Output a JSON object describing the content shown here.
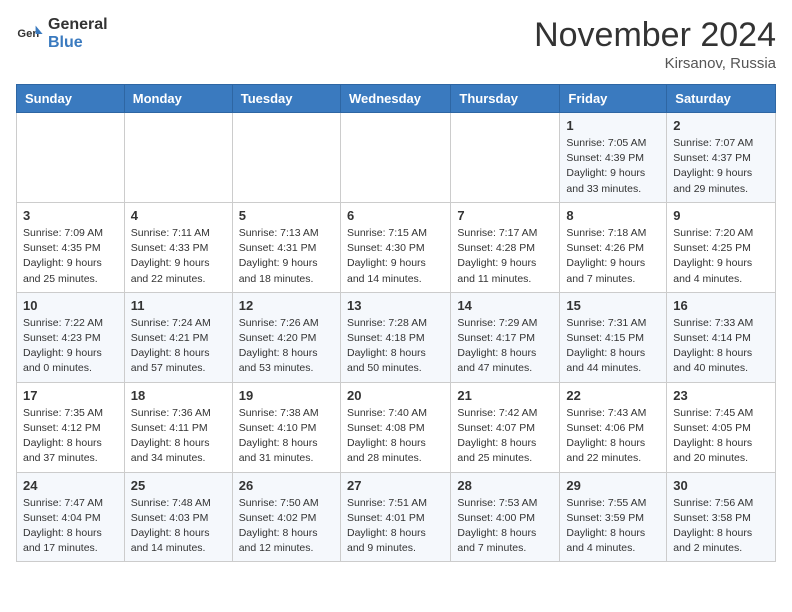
{
  "logo": {
    "text_general": "General",
    "text_blue": "Blue"
  },
  "title": {
    "month_year": "November 2024",
    "location": "Kirsanov, Russia"
  },
  "weekdays": [
    "Sunday",
    "Monday",
    "Tuesday",
    "Wednesday",
    "Thursday",
    "Friday",
    "Saturday"
  ],
  "weeks": [
    [
      {
        "day": "",
        "info": ""
      },
      {
        "day": "",
        "info": ""
      },
      {
        "day": "",
        "info": ""
      },
      {
        "day": "",
        "info": ""
      },
      {
        "day": "",
        "info": ""
      },
      {
        "day": "1",
        "info": "Sunrise: 7:05 AM\nSunset: 4:39 PM\nDaylight: 9 hours and 33 minutes."
      },
      {
        "day": "2",
        "info": "Sunrise: 7:07 AM\nSunset: 4:37 PM\nDaylight: 9 hours and 29 minutes."
      }
    ],
    [
      {
        "day": "3",
        "info": "Sunrise: 7:09 AM\nSunset: 4:35 PM\nDaylight: 9 hours and 25 minutes."
      },
      {
        "day": "4",
        "info": "Sunrise: 7:11 AM\nSunset: 4:33 PM\nDaylight: 9 hours and 22 minutes."
      },
      {
        "day": "5",
        "info": "Sunrise: 7:13 AM\nSunset: 4:31 PM\nDaylight: 9 hours and 18 minutes."
      },
      {
        "day": "6",
        "info": "Sunrise: 7:15 AM\nSunset: 4:30 PM\nDaylight: 9 hours and 14 minutes."
      },
      {
        "day": "7",
        "info": "Sunrise: 7:17 AM\nSunset: 4:28 PM\nDaylight: 9 hours and 11 minutes."
      },
      {
        "day": "8",
        "info": "Sunrise: 7:18 AM\nSunset: 4:26 PM\nDaylight: 9 hours and 7 minutes."
      },
      {
        "day": "9",
        "info": "Sunrise: 7:20 AM\nSunset: 4:25 PM\nDaylight: 9 hours and 4 minutes."
      }
    ],
    [
      {
        "day": "10",
        "info": "Sunrise: 7:22 AM\nSunset: 4:23 PM\nDaylight: 9 hours and 0 minutes."
      },
      {
        "day": "11",
        "info": "Sunrise: 7:24 AM\nSunset: 4:21 PM\nDaylight: 8 hours and 57 minutes."
      },
      {
        "day": "12",
        "info": "Sunrise: 7:26 AM\nSunset: 4:20 PM\nDaylight: 8 hours and 53 minutes."
      },
      {
        "day": "13",
        "info": "Sunrise: 7:28 AM\nSunset: 4:18 PM\nDaylight: 8 hours and 50 minutes."
      },
      {
        "day": "14",
        "info": "Sunrise: 7:29 AM\nSunset: 4:17 PM\nDaylight: 8 hours and 47 minutes."
      },
      {
        "day": "15",
        "info": "Sunrise: 7:31 AM\nSunset: 4:15 PM\nDaylight: 8 hours and 44 minutes."
      },
      {
        "day": "16",
        "info": "Sunrise: 7:33 AM\nSunset: 4:14 PM\nDaylight: 8 hours and 40 minutes."
      }
    ],
    [
      {
        "day": "17",
        "info": "Sunrise: 7:35 AM\nSunset: 4:12 PM\nDaylight: 8 hours and 37 minutes."
      },
      {
        "day": "18",
        "info": "Sunrise: 7:36 AM\nSunset: 4:11 PM\nDaylight: 8 hours and 34 minutes."
      },
      {
        "day": "19",
        "info": "Sunrise: 7:38 AM\nSunset: 4:10 PM\nDaylight: 8 hours and 31 minutes."
      },
      {
        "day": "20",
        "info": "Sunrise: 7:40 AM\nSunset: 4:08 PM\nDaylight: 8 hours and 28 minutes."
      },
      {
        "day": "21",
        "info": "Sunrise: 7:42 AM\nSunset: 4:07 PM\nDaylight: 8 hours and 25 minutes."
      },
      {
        "day": "22",
        "info": "Sunrise: 7:43 AM\nSunset: 4:06 PM\nDaylight: 8 hours and 22 minutes."
      },
      {
        "day": "23",
        "info": "Sunrise: 7:45 AM\nSunset: 4:05 PM\nDaylight: 8 hours and 20 minutes."
      }
    ],
    [
      {
        "day": "24",
        "info": "Sunrise: 7:47 AM\nSunset: 4:04 PM\nDaylight: 8 hours and 17 minutes."
      },
      {
        "day": "25",
        "info": "Sunrise: 7:48 AM\nSunset: 4:03 PM\nDaylight: 8 hours and 14 minutes."
      },
      {
        "day": "26",
        "info": "Sunrise: 7:50 AM\nSunset: 4:02 PM\nDaylight: 8 hours and 12 minutes."
      },
      {
        "day": "27",
        "info": "Sunrise: 7:51 AM\nSunset: 4:01 PM\nDaylight: 8 hours and 9 minutes."
      },
      {
        "day": "28",
        "info": "Sunrise: 7:53 AM\nSunset: 4:00 PM\nDaylight: 8 hours and 7 minutes."
      },
      {
        "day": "29",
        "info": "Sunrise: 7:55 AM\nSunset: 3:59 PM\nDaylight: 8 hours and 4 minutes."
      },
      {
        "day": "30",
        "info": "Sunrise: 7:56 AM\nSunset: 3:58 PM\nDaylight: 8 hours and 2 minutes."
      }
    ]
  ]
}
